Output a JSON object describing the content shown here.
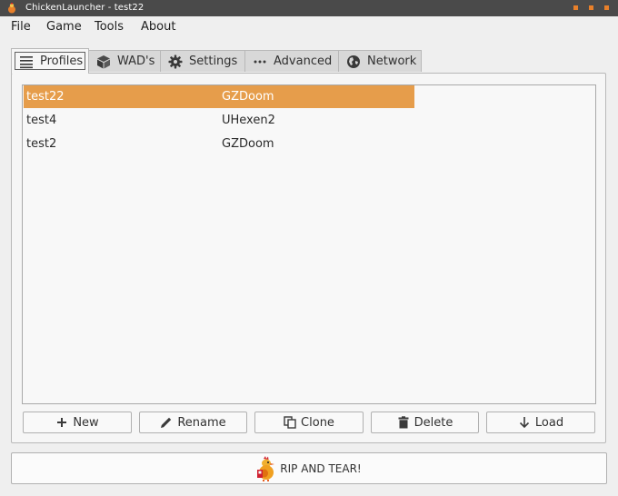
{
  "window": {
    "title": "ChickenLauncher - test22",
    "accent_color": "#e8802a",
    "titlebar_color": "#4a4a4a"
  },
  "menubar": {
    "items": [
      "File",
      "Game",
      "Tools",
      "About"
    ]
  },
  "tabs": [
    {
      "label": "Profiles",
      "icon": "list-icon",
      "active": true
    },
    {
      "label": "WAD's",
      "icon": "cube-icon",
      "active": false
    },
    {
      "label": "Settings",
      "icon": "gear-icon",
      "active": false
    },
    {
      "label": "Advanced",
      "icon": "dots-icon",
      "active": false
    },
    {
      "label": "Network",
      "icon": "globe-icon",
      "active": false
    }
  ],
  "profiles": {
    "selection_color": "#e69d4b",
    "rows": [
      {
        "name": "test22",
        "engine": "GZDoom",
        "selected": true
      },
      {
        "name": "test4",
        "engine": "UHexen2",
        "selected": false
      },
      {
        "name": "test2",
        "engine": "GZDoom",
        "selected": false
      }
    ]
  },
  "actions": {
    "new_label": "New",
    "rename_label": "Rename",
    "clone_label": "Clone",
    "delete_label": "Delete",
    "load_label": "Load"
  },
  "launch": {
    "label": "RIP AND TEAR!",
    "icon": "chicken-icon"
  }
}
